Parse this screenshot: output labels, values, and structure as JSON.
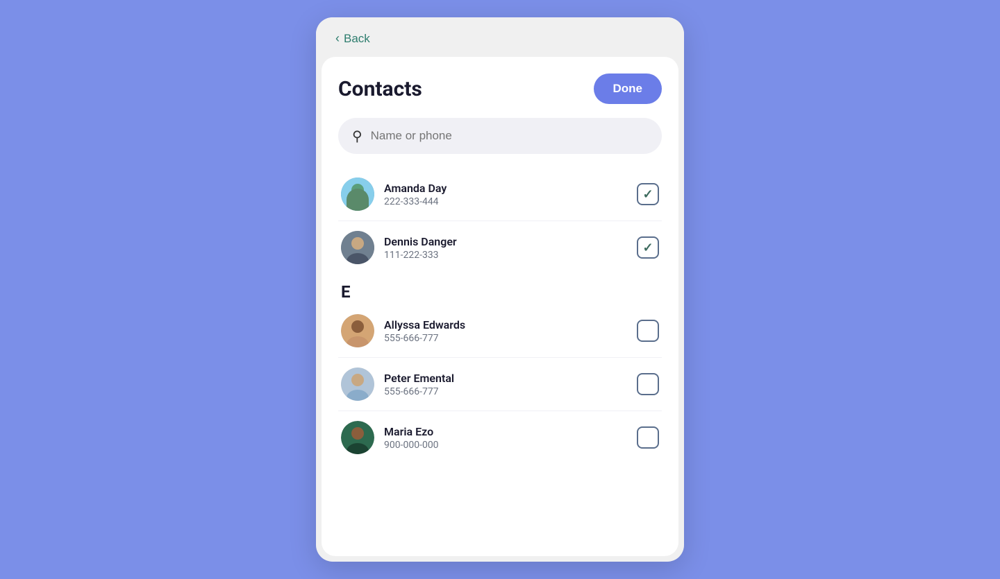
{
  "header": {
    "back_label": "Back"
  },
  "main": {
    "title": "Contacts",
    "done_label": "Done",
    "search": {
      "placeholder": "Name or phone"
    },
    "contacts": [
      {
        "name": "Amanda Day",
        "phone": "222-333-444",
        "checked": true,
        "avatar_color": "#87ceeb",
        "section": ""
      },
      {
        "name": "Dennis Danger",
        "phone": "111-222-333",
        "checked": true,
        "avatar_color": "#708090",
        "section": ""
      },
      {
        "section_label": "E"
      },
      {
        "name": "Allyssa Edwards",
        "phone": "555-666-777",
        "checked": false,
        "avatar_color": "#d4a574",
        "section": "E"
      },
      {
        "name": "Peter Emental",
        "phone": "555-666-777",
        "checked": false,
        "avatar_color": "#b0c4d8",
        "section": "E"
      },
      {
        "name": "Maria Ezo",
        "phone": "900-000-000",
        "checked": false,
        "avatar_color": "#2d6a4f",
        "section": "E"
      }
    ]
  }
}
